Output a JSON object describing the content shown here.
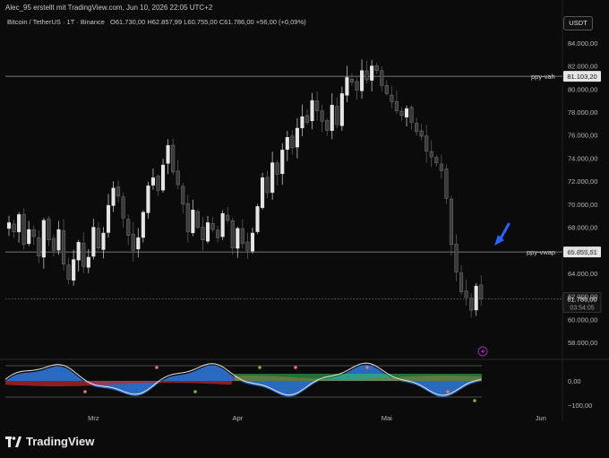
{
  "topbar": {
    "text": "Alec_95 erstellt mit TradingView.com, Jun 10, 2026 22:05 UTC+2"
  },
  "legend": {
    "symbol": "Bitcoin / TetherUS · 1T · Binance",
    "open": "O61.730,00",
    "high": "H62.857,99",
    "low": "L60.755,00",
    "close": "C61.786,00",
    "change": "+56,00 (+0,09%)"
  },
  "currency_button": "USDT",
  "footer": {
    "brand": "TradingView"
  },
  "colors": {
    "background": "#0b0b0b",
    "candle_up": "#e6e6e6",
    "candle_down": "#3a3a3a",
    "arrow": "#2962ff",
    "osc_blue": "#2f7be0",
    "osc_red": "#c62828",
    "osc_green": "#34c759",
    "lightning": "#9c27b0"
  },
  "chart_data": {
    "type": "candlestick",
    "y_axis": {
      "min": 57000,
      "max": 85000,
      "ticks": [
        58000,
        60000,
        62000,
        64000,
        66000,
        68000,
        70000,
        72000,
        74000,
        76000,
        78000,
        80000,
        82000,
        84000
      ],
      "tick_labels": [
        "58.000,00",
        "60.000,00",
        "62.000,00",
        "64.000,00",
        "66.000,00",
        "68.000,00",
        "70.000,00",
        "72.000,00",
        "74.000,00",
        "76.000,00",
        "78.000,00",
        "80.000,00",
        "82.000,00",
        "84.000,00"
      ]
    },
    "x_axis": {
      "labels": [
        {
          "text": "Mrz",
          "index": 17
        },
        {
          "text": "Apr",
          "index": 46
        },
        {
          "text": "Mai",
          "index": 76
        },
        {
          "text": "Jun",
          "index": 107
        }
      ]
    },
    "levels": [
      {
        "name": "ppy-vah",
        "value": 81103.2,
        "label": "81.103,20"
      },
      {
        "name": "ppy-vwap",
        "value": 65855.51,
        "label": "65.855,51"
      }
    ],
    "last_price": {
      "value": 61786,
      "label": "61.786,00",
      "countdown": "03:54:05"
    },
    "closes": [
      68400,
      67600,
      69100,
      66500,
      67800,
      67200,
      65500,
      68600,
      66900,
      66000,
      67800,
      64800,
      63500,
      65200,
      66700,
      64600,
      65400,
      68000,
      66200,
      67500,
      69900,
      71400,
      70700,
      68800,
      67300,
      66000,
      67100,
      69300,
      71600,
      72300,
      71200,
      73400,
      75100,
      72800,
      71700,
      70000,
      67600,
      69500,
      68000,
      66900,
      68400,
      67800,
      67100,
      69200,
      68600,
      66200,
      67900,
      66600,
      66000,
      67500,
      69800,
      72300,
      71000,
      73600,
      72600,
      74700,
      75800,
      74900,
      76600,
      77600,
      77100,
      79000,
      78100,
      77200,
      76400,
      78600,
      76900,
      79600,
      81000,
      80600,
      79900,
      81600,
      80800,
      82000,
      81600,
      80300,
      79600,
      78900,
      78100,
      77700,
      78300,
      77100,
      76300,
      75900,
      74600,
      74100,
      73600,
      72900,
      70500,
      66500,
      64100,
      62400,
      61900,
      60800,
      62900,
      61786
    ],
    "oscillator": {
      "ticks": [
        0,
        -100
      ],
      "tick_labels": [
        "0,00",
        "−100,00"
      ]
    }
  }
}
